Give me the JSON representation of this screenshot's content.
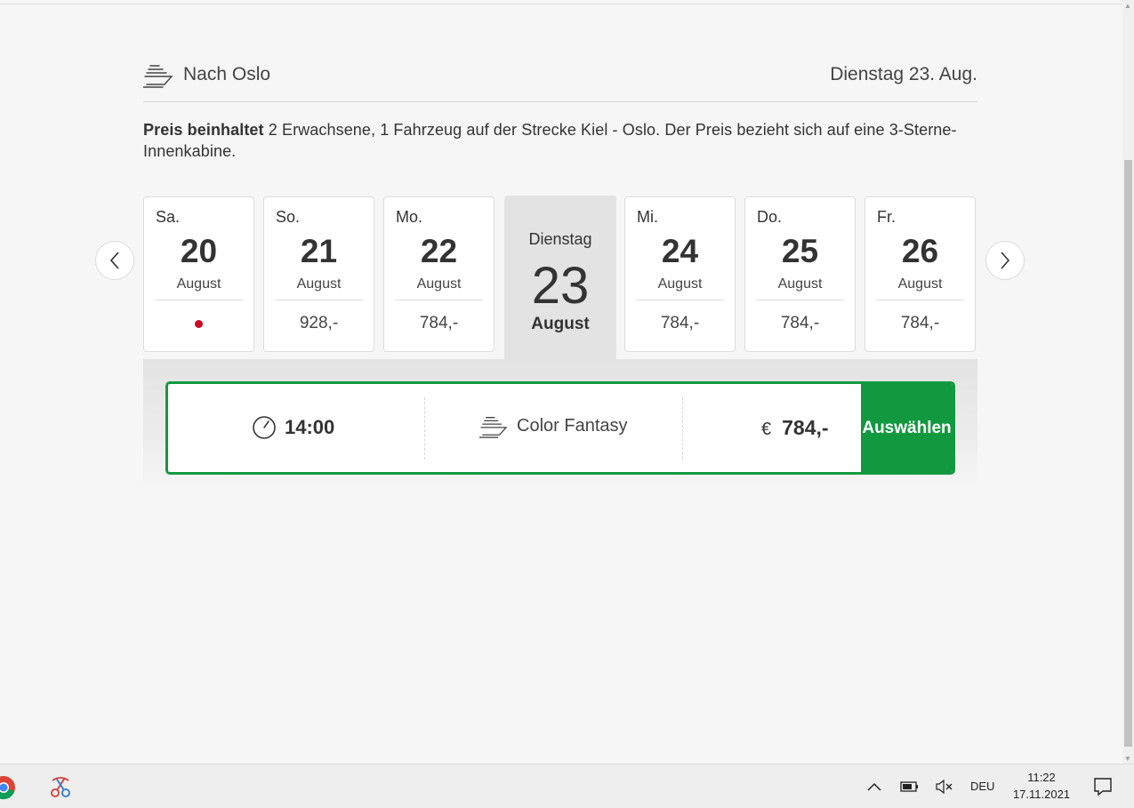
{
  "header": {
    "destination": "Nach Oslo",
    "date": "Dienstag 23. Aug."
  },
  "info": {
    "bold_prefix": "Preis beinhaltet",
    "text": " 2 Erwachsene, 1 Fahrzeug auf der Strecke Kiel - Oslo. Der Preis bezieht sich auf eine 3-Sterne-Innenkabine."
  },
  "days": [
    {
      "name": "Sa.",
      "num": "20",
      "month": "August",
      "price": "",
      "unavailable": true
    },
    {
      "name": "So.",
      "num": "21",
      "month": "August",
      "price": "928,-"
    },
    {
      "name": "Mo.",
      "num": "22",
      "month": "August",
      "price": "784,-"
    },
    {
      "name": "Mi.",
      "num": "24",
      "month": "August",
      "price": "784,-"
    },
    {
      "name": "Do.",
      "num": "25",
      "month": "August",
      "price": "784,-"
    },
    {
      "name": "Fr.",
      "num": "26",
      "month": "August",
      "price": "784,-"
    }
  ],
  "selected_day": {
    "name": "Dienstag",
    "num": "23",
    "month": "August"
  },
  "departure": {
    "time": "14:00",
    "ship": "Color Fantasy",
    "currency": "€",
    "price": "784,-",
    "select_label": "Auswählen"
  },
  "taskbar": {
    "language": "DEU",
    "time": "11:22",
    "date": "17.11.2021"
  },
  "colors": {
    "accent_green": "#12993f",
    "unavailable_red": "#cc0a1e",
    "selected_bg": "#e3e3e3"
  }
}
